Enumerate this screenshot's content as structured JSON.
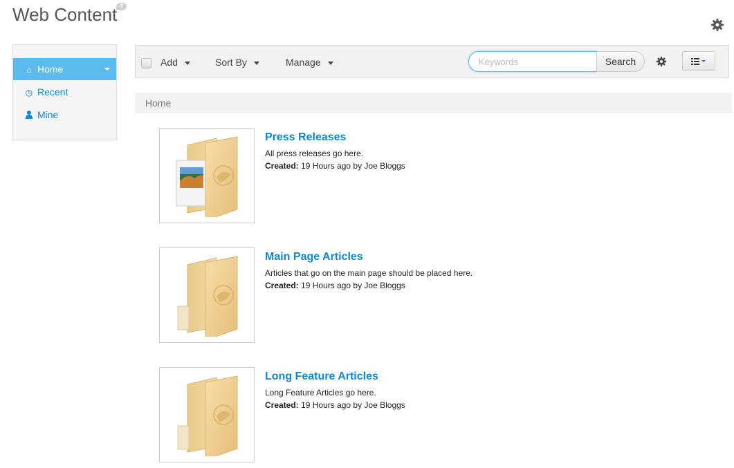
{
  "header": {
    "title": "Web Content",
    "help_glyph": "?"
  },
  "sidebar": {
    "items": [
      {
        "label": "Home",
        "icon": "home-icon",
        "active": true
      },
      {
        "label": "Recent",
        "icon": "clock-icon",
        "active": false
      },
      {
        "label": "Mine",
        "icon": "user-icon",
        "active": false
      }
    ]
  },
  "toolbar": {
    "add_label": "Add",
    "sort_label": "Sort By",
    "manage_label": "Manage",
    "search_placeholder": "Keywords",
    "search_value": "",
    "search_button": "Search"
  },
  "breadcrumb": {
    "current": "Home"
  },
  "folders": [
    {
      "title": "Press Releases",
      "description": "All press releases go here.",
      "created_label": "Created:",
      "created_value": "19 Hours ago by Joe Bloggs",
      "has_image": true
    },
    {
      "title": "Main Page Articles",
      "description": "Articles that go on the main page should be placed here.",
      "created_label": "Created:",
      "created_value": "19 Hours ago by Joe Bloggs",
      "has_image": false
    },
    {
      "title": "Long Feature Articles",
      "description": "Long Feature Articles go here.",
      "created_label": "Created:",
      "created_value": "19 Hours ago by Joe Bloggs",
      "has_image": false
    }
  ],
  "colors": {
    "accent": "#0c88d0",
    "active_nav": "#5bbbef",
    "toolbar_bg": "#f2f2f2"
  }
}
